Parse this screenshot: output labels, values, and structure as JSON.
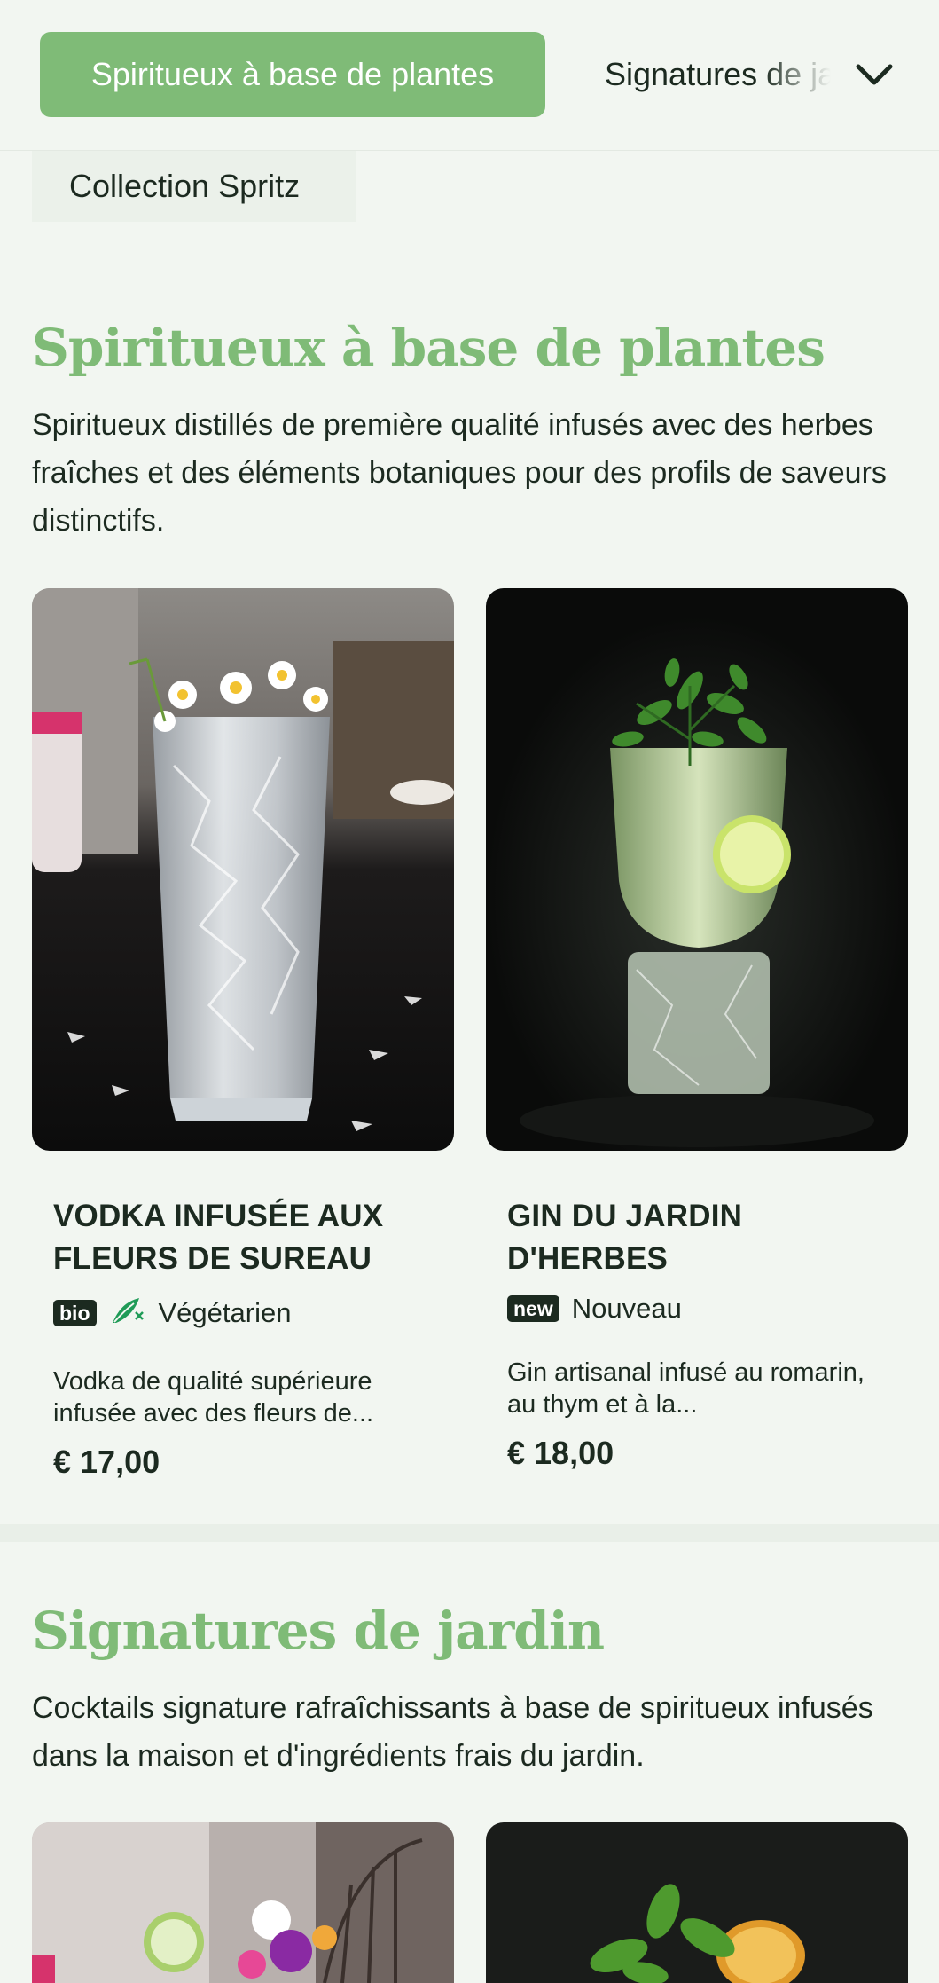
{
  "nav": {
    "active_label": "Spiritueux à base de plantes",
    "next_label": "Signatures de jardin",
    "row2_label": "Collection Spritz",
    "chevron_icon": "chevron-down-icon"
  },
  "sections": [
    {
      "title": "Spiritueux à base de plantes",
      "description": "Spiritueux distillés de première qualité infusés avec des herbes fraîches et des éléments botaniques pour des profils de saveurs distinctifs.",
      "products": [
        {
          "name": "VODKA INFUSÉE AUX FLEURS DE SUREAU",
          "badge": "bio",
          "tag_icon": "vegetarian-leaf-icon",
          "tag_label": "Végétarien",
          "description": "Vodka de qualité supérieure infusée avec des fleurs de...",
          "price": "€ 17,00"
        },
        {
          "name": "GIN DU JARDIN D'HERBES",
          "badge": "new",
          "tag_label": "Nouveau",
          "description": "Gin artisanal infusé au romarin, au thym et à la...",
          "price": "€ 18,00"
        }
      ]
    },
    {
      "title": "Signatures de jardin",
      "description": "Cocktails signature rafraîchissants à base de spiritueux infusés dans la maison et d'ingrédients frais du jardin."
    }
  ],
  "colors": {
    "accent": "#7fbb77",
    "background": "#f2f6f1",
    "text": "#1c2a20",
    "leaf_icon": "#1f9b57"
  }
}
